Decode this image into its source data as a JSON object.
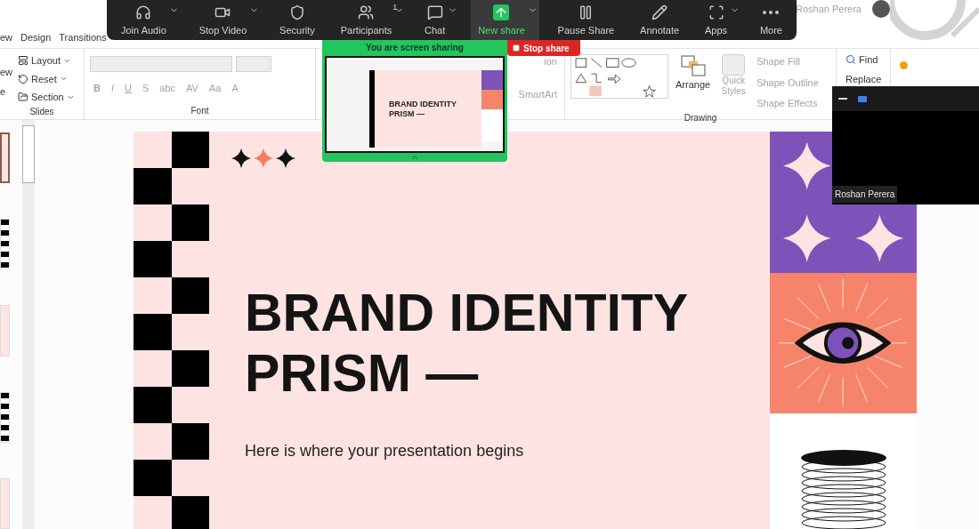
{
  "ribbon_tabs": [
    {
      "label": "ew",
      "selected": false
    },
    {
      "label": "Design",
      "selected": false
    },
    {
      "label": "Transitions",
      "selected": false
    }
  ],
  "account": {
    "name": "Roshan Perera"
  },
  "ribbon": {
    "slides_group": {
      "label": "Slides",
      "cut_labels": [
        "ew",
        "e"
      ],
      "items": [
        "Layout",
        "Reset",
        "Section"
      ]
    },
    "font_group": {
      "label": "Font",
      "disabled": true,
      "buttons": [
        "B",
        "I",
        "U",
        "S",
        "abc",
        "AV",
        "Aa",
        "A"
      ]
    },
    "paragraph_group": {
      "cut_label": "ion",
      "smartart": "SmartArt"
    },
    "drawing_group": {
      "label": "Drawing",
      "arrange": "Arrange",
      "quick_styles": "Quick Styles",
      "disabled": true,
      "shape_buttons": [
        "Shape Fill",
        "Shape Outline",
        "Shape Effects"
      ]
    },
    "editing_group": {
      "find": "Find",
      "replace": "Replace"
    }
  },
  "zoom_toolbar": {
    "buttons": [
      {
        "label": "Join Audio",
        "selected": false,
        "caret": true
      },
      {
        "label": "Stop Video",
        "selected": false,
        "caret": true
      },
      {
        "label": "Security",
        "selected": false,
        "caret": false
      },
      {
        "label": "Participants",
        "selected": false,
        "caret": true,
        "badge": "1"
      },
      {
        "label": "Chat",
        "selected": false,
        "caret": true
      },
      {
        "label": "New share",
        "selected": true,
        "caret": true
      },
      {
        "label": "Pause Share",
        "selected": false,
        "caret": false
      },
      {
        "label": "Annotate",
        "selected": false,
        "caret": false
      },
      {
        "label": "Apps",
        "selected": false,
        "caret": true
      },
      {
        "label": "More",
        "selected": false,
        "caret": false
      }
    ]
  },
  "share_banner": {
    "text": "You are screen sharing",
    "stop_button": "Stop share",
    "preview_title": "BRAND IDENTITY PRISM —"
  },
  "slide_panel": {
    "thumbnails": [
      {
        "selected": true
      },
      {
        "selected": false
      },
      {
        "selected": false
      },
      {
        "selected": false
      },
      {
        "selected": false
      }
    ]
  },
  "slide": {
    "title": "BRAND IDENTITY PRISM —",
    "subtitle": "Here is where your presentation begins"
  },
  "video_window": {
    "name": "Roshan Perera"
  }
}
